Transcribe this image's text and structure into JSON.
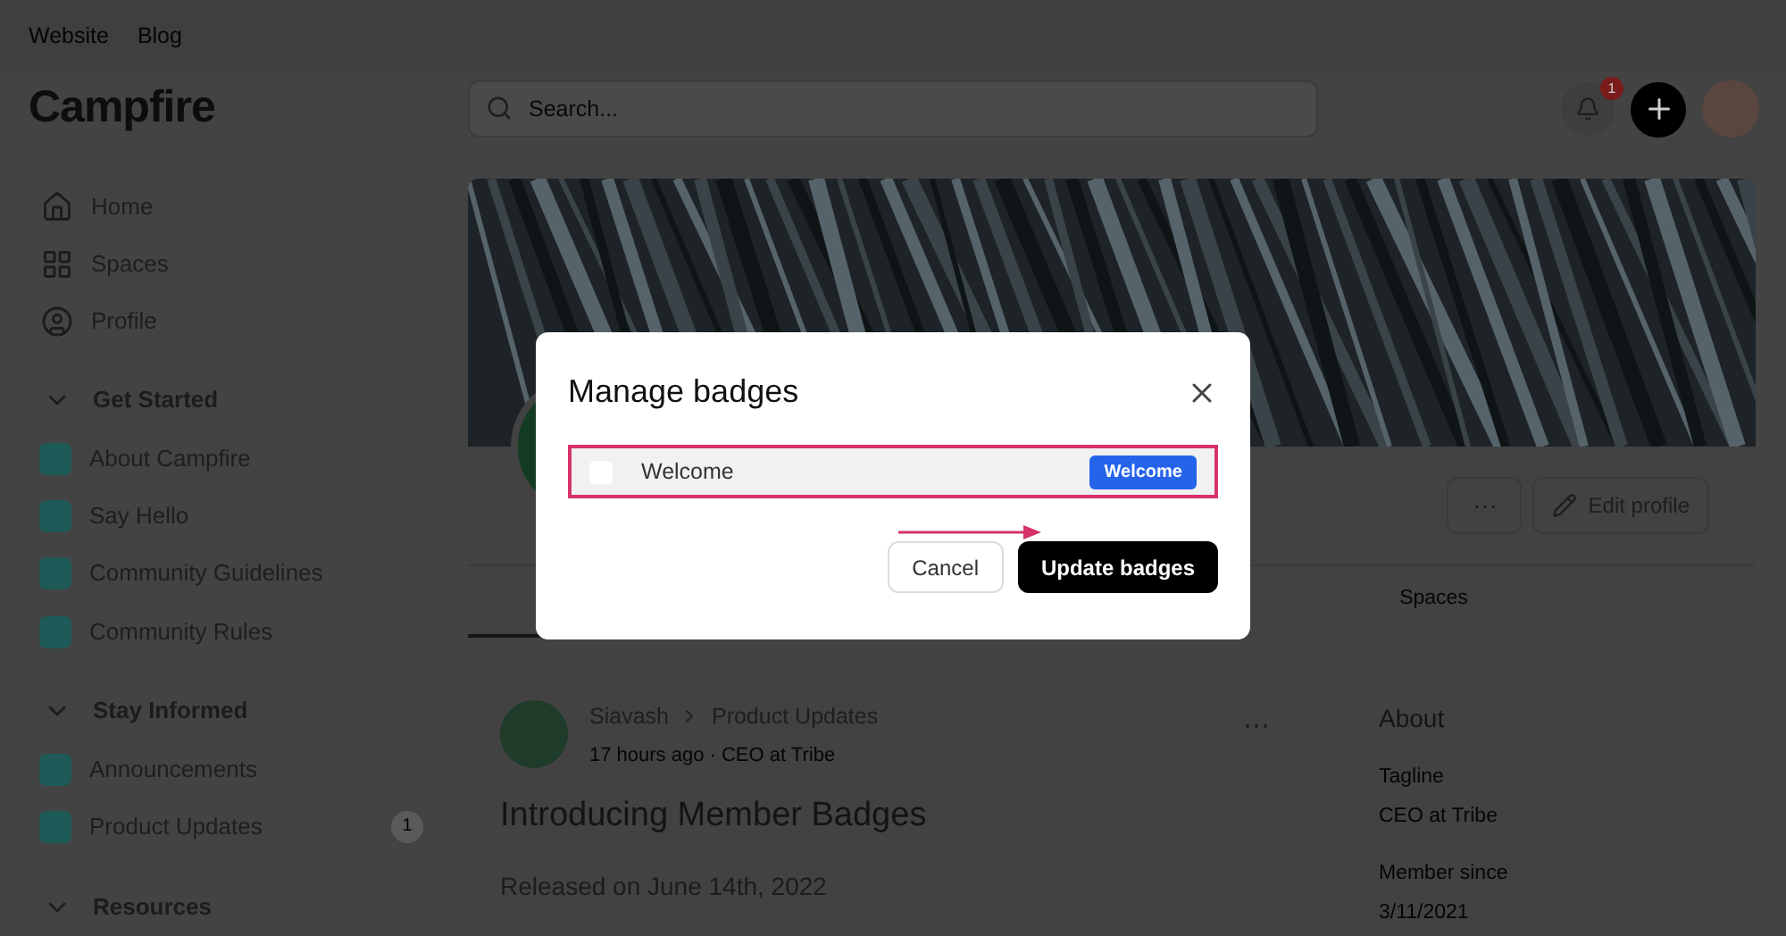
{
  "top_links": [
    "Website",
    "Blog"
  ],
  "logo": "Campfire",
  "search": {
    "placeholder": "Search..."
  },
  "notifications": {
    "count": "1"
  },
  "sidebar": {
    "items": [
      {
        "kind": "nav",
        "label": "Home"
      },
      {
        "kind": "nav",
        "label": "Spaces"
      },
      {
        "kind": "nav",
        "label": "Profile"
      },
      {
        "kind": "section",
        "label": "Get Started",
        "expanded": true
      },
      {
        "kind": "space",
        "label": "About Campfire"
      },
      {
        "kind": "space",
        "label": "Say Hello"
      },
      {
        "kind": "space",
        "label": "Community Guidelines"
      },
      {
        "kind": "space",
        "label": "Community Rules"
      },
      {
        "kind": "section",
        "label": "Stay Informed",
        "expanded": true
      },
      {
        "kind": "space",
        "label": "Announcements"
      },
      {
        "kind": "space",
        "label": "Product Updates",
        "count": "1"
      },
      {
        "kind": "section",
        "label": "Resources",
        "expanded": true
      }
    ]
  },
  "profile": {
    "actions": [
      {
        "kind": "more",
        "label": "⋯"
      },
      {
        "kind": "edit",
        "label": "Edit profile"
      }
    ],
    "tabs": [
      {
        "selected": true
      },
      {
        "label": "Spaces",
        "selected": false
      }
    ]
  },
  "post": {
    "author": "Siavash",
    "space": "Product Updates",
    "meta": "17 hours ago · CEO at Tribe",
    "more": "⋯",
    "title": "Introducing Member Badges",
    "body": "Released on June 14th, 2022"
  },
  "about": {
    "title": "About",
    "fields": [
      {
        "label": "Tagline",
        "value": "CEO at Tribe"
      },
      {
        "label": "Member since",
        "value": "3/11/2021"
      }
    ]
  },
  "dialog": {
    "title": "Manage badges",
    "arrow": true,
    "badges": [
      {
        "name": "Welcome",
        "checked": false,
        "tag": "Welcome",
        "color": "#2563eb",
        "highlighted": true
      }
    ],
    "buttons": [
      {
        "kind": "secondary",
        "label": "Cancel"
      },
      {
        "kind": "primary",
        "label": "Update badges"
      }
    ]
  }
}
